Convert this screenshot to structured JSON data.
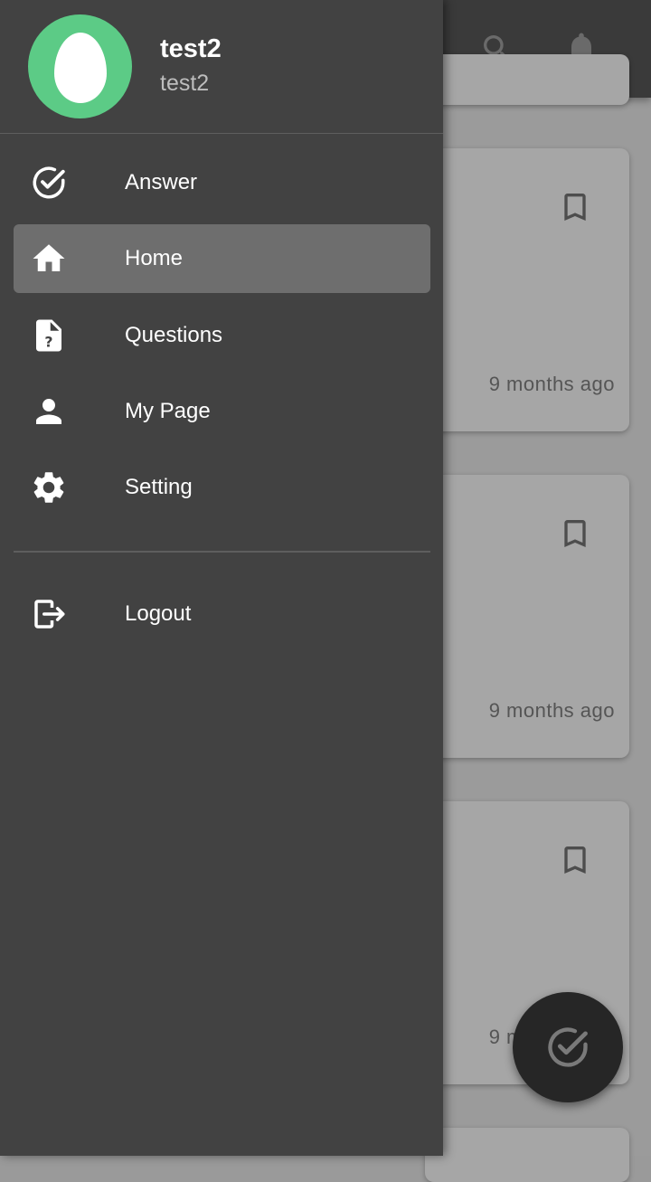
{
  "user": {
    "name": "test2",
    "handle": "test2"
  },
  "menu": [
    {
      "label": "Answer",
      "icon": "check-circle-icon"
    },
    {
      "label": "Home",
      "icon": "home-icon",
      "active": true
    },
    {
      "label": "Questions",
      "icon": "question-file-icon"
    },
    {
      "label": "My Page",
      "icon": "person-icon"
    },
    {
      "label": "Setting",
      "icon": "gear-icon"
    }
  ],
  "logout": {
    "label": "Logout",
    "icon": "logout-icon"
  },
  "cards": [
    {
      "time": "9 months ago"
    },
    {
      "time": "9 months ago"
    },
    {
      "time": "9 months ago"
    }
  ],
  "colors": {
    "drawer": "#424242",
    "active_item": "#6e6e6e",
    "avatar": "#5ccb86",
    "appbar": "#3a3a3a",
    "fab": "#262626"
  }
}
